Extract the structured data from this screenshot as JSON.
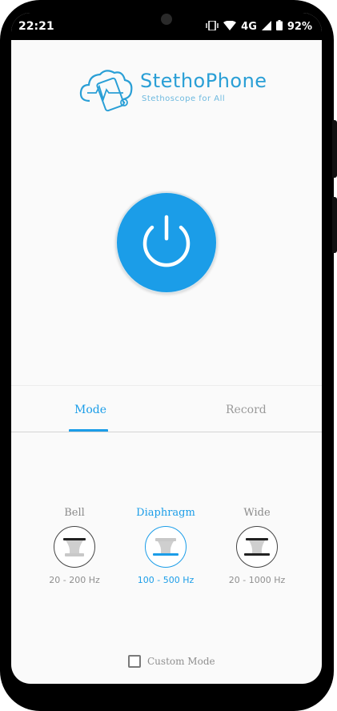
{
  "status_bar": {
    "time": "22:21",
    "network": "4G",
    "battery": "92%",
    "icons": [
      "vibrate-icon",
      "wifi-icon",
      "signal-icon",
      "battery-icon"
    ]
  },
  "app": {
    "title": "StethoPhone",
    "subtitle": "Stethoscope for All",
    "power_icon": "power-icon",
    "accent_color": "#1b9de8"
  },
  "tabs": [
    {
      "label": "Mode",
      "selected": true
    },
    {
      "label": "Record",
      "selected": false
    }
  ],
  "modes": [
    {
      "name": "Bell",
      "range": "20 - 200 Hz",
      "selected": false,
      "icon": "bell-chestpiece-icon"
    },
    {
      "name": "Diaphragm",
      "range": "100 - 500 Hz",
      "selected": true,
      "icon": "diaphragm-chestpiece-icon"
    },
    {
      "name": "Wide",
      "range": "20 - 1000 Hz",
      "selected": false,
      "icon": "wide-chestpiece-icon"
    }
  ],
  "custom_mode": {
    "label": "Custom Mode",
    "checked": false
  }
}
